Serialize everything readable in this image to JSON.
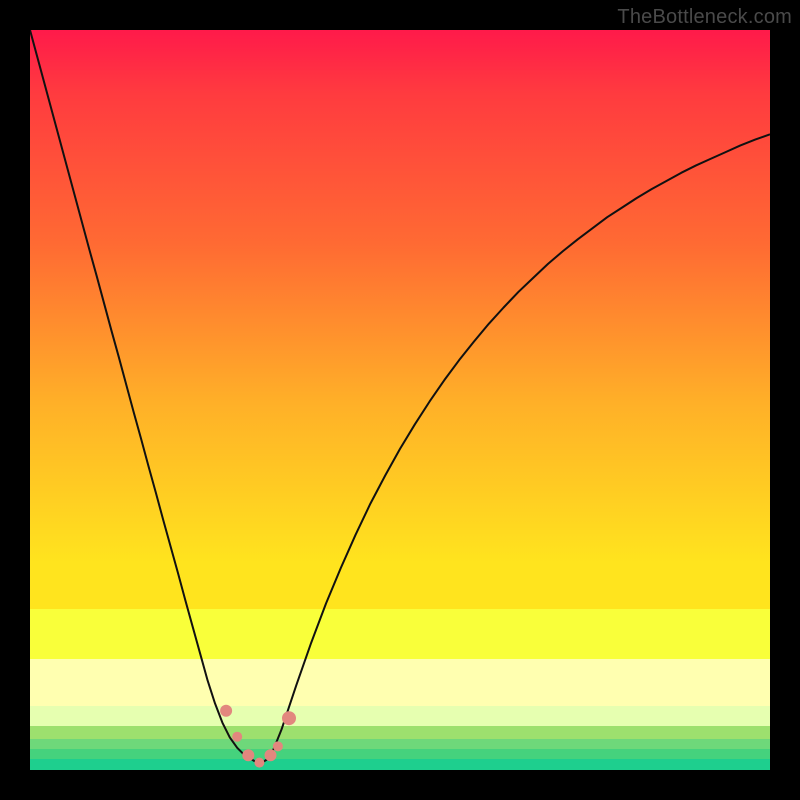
{
  "watermark": "TheBottleneck.com",
  "colors": {
    "black": "#000000",
    "curve": "#111111",
    "dot": "#e2877e",
    "grad_top": "#ff1a4a",
    "grad_mid1": "#ff6a33",
    "grad_mid2": "#ffb028",
    "grad_mid3": "#ffe41e",
    "grad_mid4": "#f9ff3a",
    "grad_low": "#ffffb0",
    "green1": "#9de06e",
    "green2": "#45d27d",
    "green3": "#1ecf8e"
  },
  "chart_data": {
    "type": "line",
    "title": "",
    "xlabel": "",
    "ylabel": "",
    "xlim": [
      0,
      1
    ],
    "ylim": [
      0,
      1
    ],
    "x": [
      0.0,
      0.01,
      0.02,
      0.03,
      0.04,
      0.05,
      0.06,
      0.07,
      0.08,
      0.09,
      0.1,
      0.11,
      0.12,
      0.13,
      0.14,
      0.15,
      0.16,
      0.17,
      0.18,
      0.19,
      0.2,
      0.21,
      0.22,
      0.23,
      0.24,
      0.25,
      0.26,
      0.27,
      0.28,
      0.29,
      0.3,
      0.305,
      0.31,
      0.315,
      0.32,
      0.325,
      0.33,
      0.34,
      0.35,
      0.36,
      0.38,
      0.4,
      0.42,
      0.44,
      0.46,
      0.48,
      0.5,
      0.52,
      0.54,
      0.56,
      0.58,
      0.6,
      0.62,
      0.64,
      0.66,
      0.68,
      0.7,
      0.72,
      0.74,
      0.76,
      0.78,
      0.8,
      0.82,
      0.84,
      0.86,
      0.88,
      0.9,
      0.92,
      0.94,
      0.96,
      0.98,
      1.0
    ],
    "series": [
      {
        "name": "bottleneck-curve",
        "values": [
          1.0,
          0.963,
          0.926,
          0.889,
          0.852,
          0.815,
          0.778,
          0.741,
          0.704,
          0.668,
          0.631,
          0.594,
          0.558,
          0.521,
          0.484,
          0.448,
          0.411,
          0.375,
          0.338,
          0.302,
          0.266,
          0.229,
          0.193,
          0.157,
          0.121,
          0.09,
          0.064,
          0.044,
          0.03,
          0.02,
          0.014,
          0.011,
          0.01,
          0.011,
          0.014,
          0.02,
          0.03,
          0.055,
          0.085,
          0.115,
          0.172,
          0.225,
          0.273,
          0.318,
          0.36,
          0.398,
          0.434,
          0.467,
          0.498,
          0.527,
          0.554,
          0.579,
          0.603,
          0.625,
          0.646,
          0.665,
          0.684,
          0.701,
          0.717,
          0.732,
          0.747,
          0.76,
          0.773,
          0.785,
          0.796,
          0.807,
          0.817,
          0.826,
          0.835,
          0.844,
          0.852,
          0.859
        ]
      }
    ],
    "markers": {
      "name": "highlight-dots",
      "x": [
        0.265,
        0.28,
        0.295,
        0.31,
        0.325,
        0.335,
        0.35
      ],
      "y": [
        0.08,
        0.045,
        0.02,
        0.01,
        0.02,
        0.032,
        0.07
      ],
      "r": [
        6,
        5,
        6,
        5,
        6,
        5,
        7
      ]
    },
    "background_bands": [
      {
        "from": 0.0,
        "to": 0.72,
        "type": "gradient"
      },
      {
        "from": 0.72,
        "to": 0.782,
        "color": "#ffe41e"
      },
      {
        "from": 0.782,
        "to": 0.85,
        "color": "#f9ff3a"
      },
      {
        "from": 0.85,
        "to": 0.914,
        "color": "#ffffb0"
      },
      {
        "from": 0.914,
        "to": 0.94,
        "color": "#e6ffb0"
      },
      {
        "from": 0.94,
        "to": 0.958,
        "color": "#9de06e"
      },
      {
        "from": 0.958,
        "to": 0.972,
        "color": "#6ed87a"
      },
      {
        "from": 0.972,
        "to": 0.985,
        "color": "#45d27d"
      },
      {
        "from": 0.985,
        "to": 1.0,
        "color": "#1ecf8e"
      }
    ]
  }
}
